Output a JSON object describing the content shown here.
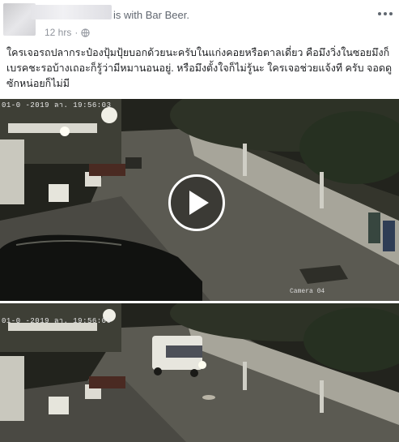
{
  "post": {
    "author_suffix": "is with Bar Beer.",
    "time": "12 hrs",
    "privacy_icon": "globe-icon",
    "more_icon": "more-options-icon",
    "text": "ใครเจอรถปลากระป๋องปุ้มปุ้ยบอกด้วยนะครับในแก่งคอยหรือตาลเดี่ยว คือมึงวิ่งในซอยมึงก็เบรคชะรอบ้างเถอะก็รู้ว่ามีหมานอนอยู่. หรือมึงตั้งใจก็ไม่รู้นะ ใครเจอช่วยแจ้งที ครับ จอดดูซักหน่อยก็ไม่มี"
  },
  "video": {
    "timestamp_top": "01-0 -2019 ลา. 19:56:03",
    "camera_label": "Camera 04",
    "play_icon": "play-icon",
    "timestamp_bottom": "01-0 -2019 ลา. 19:56:09"
  },
  "colors": {
    "meta": "#90949c",
    "text": "#1c1e21",
    "play_ring": "#ffffff"
  }
}
